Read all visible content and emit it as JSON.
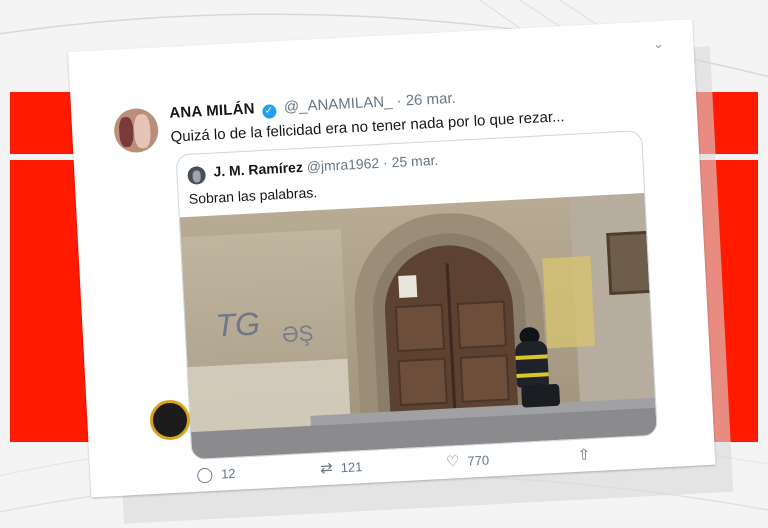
{
  "tweet": {
    "author_name": "ANA MILÁN",
    "handle": "@_ANAMILAN_",
    "date": "· 26 mar.",
    "text": "Quizá lo de la felicidad era no tener nada por lo que rezar...",
    "quoted": {
      "author_name": "J. M. Ramírez",
      "handle": "@jmra1962",
      "date": "· 25 mar.",
      "text": "Sobran las palabras."
    },
    "actions": {
      "replies": "12",
      "retweets": "121",
      "likes": "770"
    }
  },
  "colors": {
    "background_red": "#ff1a00",
    "verified_blue": "#1da1f2",
    "muted_text": "#657786"
  },
  "icons": [
    "chevron-down-icon",
    "verified-icon",
    "reply-icon",
    "retweet-icon",
    "like-icon",
    "share-icon"
  ],
  "photo_graffiti": {
    "left": "TG",
    "right": "ƏŞ"
  }
}
